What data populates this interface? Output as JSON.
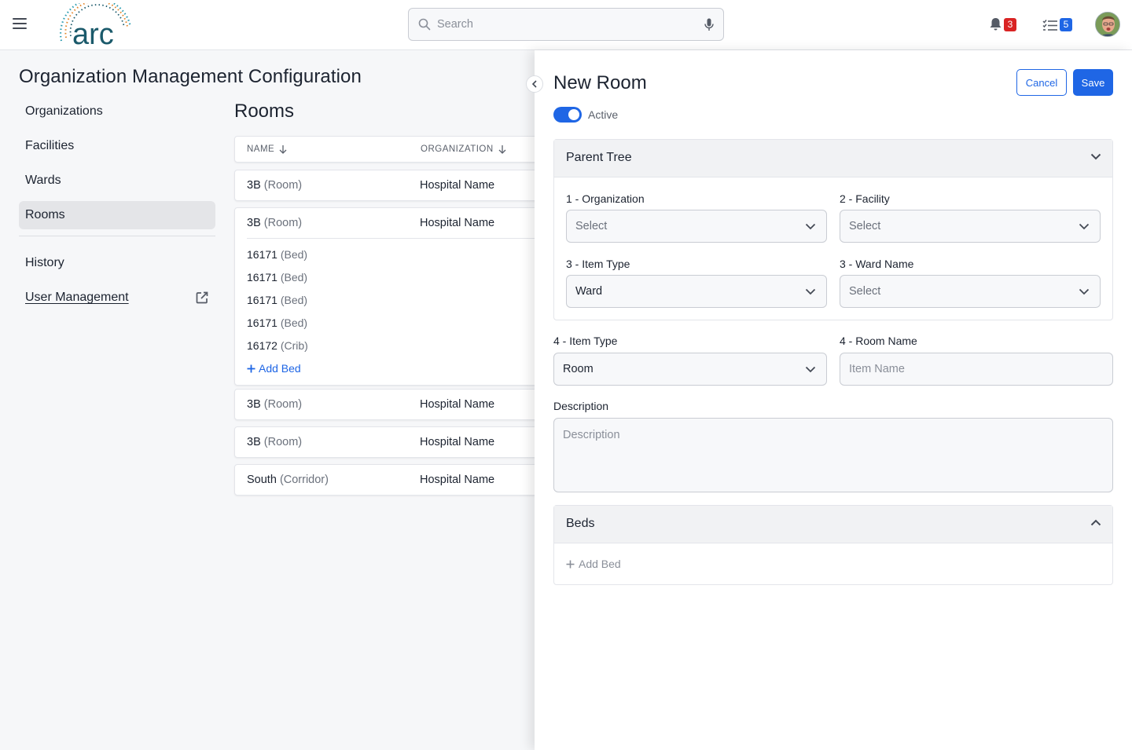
{
  "header": {
    "search_placeholder": "Search",
    "notifications_count": "3",
    "tasks_count": "5",
    "logo_text": "arc"
  },
  "page": {
    "title": "Organization Management Configuration"
  },
  "sidebar": {
    "items": [
      {
        "label": "Organizations"
      },
      {
        "label": "Facilities"
      },
      {
        "label": "Wards"
      },
      {
        "label": "Rooms"
      },
      {
        "label": "History"
      },
      {
        "label": "User Management"
      }
    ],
    "active": "Rooms"
  },
  "rooms": {
    "title": "Rooms",
    "columns": [
      "NAME",
      "ORGANIZATION"
    ],
    "rows": [
      {
        "name": "3B",
        "type": "(Room)",
        "org": "Hospital Name"
      },
      {
        "name": "3B",
        "type": "(Room)",
        "org": "Hospital Name",
        "beds": [
          {
            "name": "16171",
            "type": "(Bed)"
          },
          {
            "name": "16171",
            "type": "(Bed)"
          },
          {
            "name": "16171",
            "type": "(Bed)"
          },
          {
            "name": "16171",
            "type": "(Bed)"
          },
          {
            "name": "16172",
            "type": "(Crib)"
          }
        ],
        "add_bed_label": "Add Bed"
      },
      {
        "name": "3B",
        "type": "(Room)",
        "org": "Hospital Name"
      },
      {
        "name": "3B",
        "type": "(Room)",
        "org": "Hospital Name"
      },
      {
        "name": "South",
        "type": "(Corridor)",
        "org": "Hospital Name"
      }
    ]
  },
  "panel": {
    "title": "New Room",
    "cancel_label": "Cancel",
    "save_label": "Save",
    "active_label": "Active",
    "parent_tree": {
      "title": "Parent Tree",
      "organization_label": "1 - Organization",
      "organization_value": "Select",
      "facility_label": "2 - Facility",
      "facility_value": "Select",
      "item_type_label": "3 - Item Type",
      "item_type_value": "Ward",
      "ward_name_label": "3 - Ward Name",
      "ward_name_value": "Select"
    },
    "item_type_label": "4 - Item Type",
    "item_type_value": "Room",
    "room_name_label": "4 - Room Name",
    "room_name_placeholder": "Item Name",
    "description_label": "Description",
    "description_placeholder": "Description",
    "beds": {
      "title": "Beds",
      "add_bed_label": "Add Bed"
    }
  },
  "colors": {
    "accent": "#1f66e5",
    "badge_red": "#d92424",
    "logo_teal": "#1b5a6b",
    "logo_orange": "#e2862b"
  }
}
